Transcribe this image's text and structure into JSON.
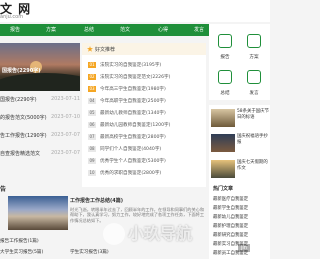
{
  "header": {
    "logo_text": "文 网",
    "logo_sub": "anju.com"
  },
  "nav": {
    "items": [
      "报告",
      "方案",
      "总结",
      "范文",
      "心得",
      "发言"
    ]
  },
  "slider": {
    "caption": "国报告(2290字)"
  },
  "left_list": [
    {
      "title": "国报告(2290字)",
      "date": "2023-07-11"
    },
    {
      "title": "的报告范文(5000字)",
      "date": "2023-07-10"
    },
    {
      "title": "告工作报告(1290字)",
      "date": "2023-07-07"
    },
    {
      "title": "自查报告精选范文",
      "date": "2023-07-07"
    }
  ],
  "mid_card": {
    "header_title": "好文推荐",
    "items": [
      {
        "num": "01",
        "text": "法院实习的自我鉴定(3195字)"
      },
      {
        "num": "02",
        "text": "法院实习的自我鉴定范文(2226字)"
      },
      {
        "num": "03",
        "text": "今年高三学生自我鉴定(1980字)"
      },
      {
        "num": "04",
        "text": "今年高职学生自我鉴定(2500字)"
      },
      {
        "num": "05",
        "text": "最新幼儿教师自我鉴定(1340字)"
      },
      {
        "num": "06",
        "text": "最新幼儿园教师自我鉴定(1200字)"
      },
      {
        "num": "07",
        "text": "最新高校学生自我鉴定(2800字)"
      },
      {
        "num": "08",
        "text": "同学们个人自我鉴定(4040字)"
      },
      {
        "num": "09",
        "text": "优秀学生个人自我鉴定(5300字)"
      },
      {
        "num": "10",
        "text": "优秀的求职自我鉴定(2800字)"
      }
    ]
  },
  "right_grid": {
    "cells": [
      "报告",
      "方案",
      "总结",
      "发言"
    ]
  },
  "right_list": [
    {
      "text": "58条关于国庆节日的标语"
    },
    {
      "text": "国庆祝福语手抄报"
    },
    {
      "text": "国庆七天假期的作文"
    }
  ],
  "bottom": {
    "section_title": "告",
    "main_title": "工作报告工作总结(4篇)",
    "desc": "时光飞逝，转眼半年过去了，回顾半年的工作，在领导和同事们的关心和帮助下，我认真学习，努力工作，较好地完成了各项工作任务，下面将工作情况总结如下。",
    "links": [
      "报告工作报告(1篇)",
      "大学生实习报告(5篇)",
      "学生实习报告(3篇)"
    ]
  },
  "right_bottom": {
    "title": "热门文章",
    "items": [
      "最新医疗自我鉴定",
      "最新学生自我鉴定",
      "最新幼儿自我鉴定",
      "最新护理自我鉴定",
      "最新研究自我鉴定",
      "最新实习自我鉴定",
      "最新员工自我鉴定"
    ]
  },
  "watermark": {
    "text": "小玖导航",
    "tag": "jin"
  },
  "colors": {
    "brand": "#1f8f3a",
    "highlight": "#f5a623"
  }
}
